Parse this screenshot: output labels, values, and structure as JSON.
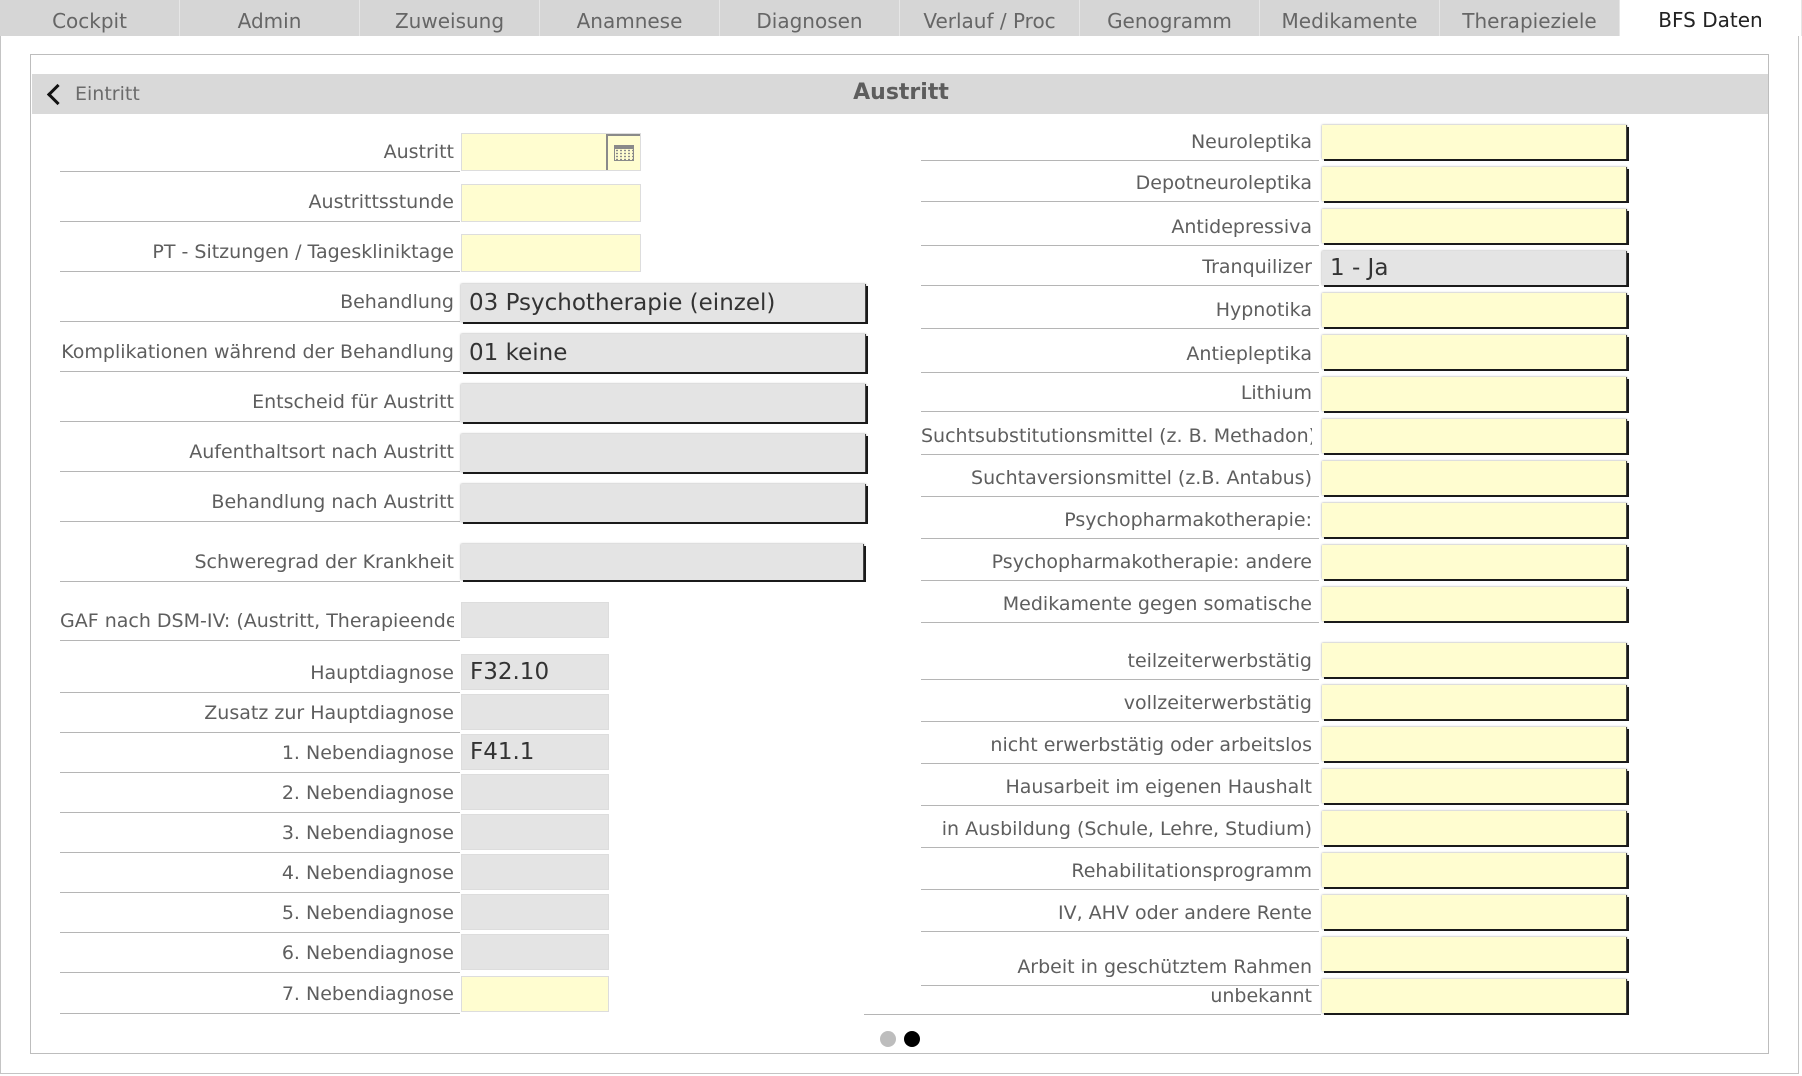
{
  "tabs": [
    {
      "label": "Cockpit",
      "active": false
    },
    {
      "label": "Admin",
      "active": false
    },
    {
      "label": "Zuweisung",
      "active": false
    },
    {
      "label": "Anamnese",
      "active": false
    },
    {
      "label": "Diagnosen",
      "active": false
    },
    {
      "label": "Verlauf / Proc",
      "active": false
    },
    {
      "label": "Genogramm",
      "active": false
    },
    {
      "label": "Medikamente",
      "active": false
    },
    {
      "label": "Therapieziele",
      "active": false
    },
    {
      "label": "BFS Daten",
      "active": true
    }
  ],
  "header": {
    "back_label": "Eintritt",
    "title": "Austritt"
  },
  "left_fields": [
    {
      "label": "Austritt",
      "value": "",
      "style": "yellow",
      "kind": "date"
    },
    {
      "label": "Austrittsstunde",
      "value": "",
      "style": "yellow",
      "kind": "text"
    },
    {
      "label": "PT - Sitzungen /  Tageskliniktage",
      "value": "",
      "style": "yellow",
      "kind": "text"
    },
    {
      "label": "Behandlung",
      "value": "03 Psychotherapie (einzel)",
      "style": "gray",
      "kind": "combo"
    },
    {
      "label": "Komplikationen während der Behandlung",
      "value": "01 keine",
      "style": "gray",
      "kind": "combo"
    },
    {
      "label": "Entscheid für Austritt",
      "value": "",
      "style": "gray",
      "kind": "combo"
    },
    {
      "label": "Aufenthaltsort nach Austritt",
      "value": "",
      "style": "gray",
      "kind": "combo"
    },
    {
      "label": "Behandlung nach Austritt",
      "value": "",
      "style": "gray",
      "kind": "combo"
    },
    {
      "label": "Schweregrad der Krankheit",
      "value": "",
      "style": "gray",
      "kind": "combo"
    },
    {
      "label": "GAF nach DSM-IV: (Austritt, Therapieende)",
      "value": "",
      "style": "gray",
      "kind": "text"
    },
    {
      "label": "Hauptdiagnose",
      "value": "F32.10",
      "style": "gray",
      "kind": "text"
    },
    {
      "label": "Zusatz zur Hauptdiagnose",
      "value": "",
      "style": "gray",
      "kind": "text"
    },
    {
      "label": "1. Nebendiagnose",
      "value": "F41.1",
      "style": "gray",
      "kind": "text"
    },
    {
      "label": "2. Nebendiagnose",
      "value": "",
      "style": "gray",
      "kind": "text"
    },
    {
      "label": "3. Nebendiagnose",
      "value": "",
      "style": "gray",
      "kind": "text"
    },
    {
      "label": "4. Nebendiagnose",
      "value": "",
      "style": "gray",
      "kind": "text"
    },
    {
      "label": "5. Nebendiagnose",
      "value": "",
      "style": "gray",
      "kind": "text"
    },
    {
      "label": "6. Nebendiagnose",
      "value": "",
      "style": "gray",
      "kind": "text"
    },
    {
      "label": "7. Nebendiagnose",
      "value": "",
      "style": "yellow",
      "kind": "text"
    }
  ],
  "right_fields": [
    {
      "label": "Neuroleptika",
      "value": "",
      "style": "yellow"
    },
    {
      "label": "Depotneuroleptika",
      "value": "",
      "style": "yellow"
    },
    {
      "label": "Antidepressiva",
      "value": "",
      "style": "yellow"
    },
    {
      "label": "Tranquilizer",
      "value": "1 - Ja",
      "style": "gray"
    },
    {
      "label": "Hypnotika",
      "value": "",
      "style": "yellow"
    },
    {
      "label": "Antiepleptika",
      "value": "",
      "style": "yellow"
    },
    {
      "label": "Lithium",
      "value": "",
      "style": "yellow"
    },
    {
      "label": "Suchtsubstitutionsmittel (z. B. Methadon)",
      "value": "",
      "style": "yellow"
    },
    {
      "label": "Suchtaversionsmittel (z.B. Antabus)",
      "value": "",
      "style": "yellow"
    },
    {
      "label": "Psychopharmakotherapie:",
      "value": "",
      "style": "yellow"
    },
    {
      "label": "Psychopharmakotherapie: andere",
      "value": "",
      "style": "yellow"
    },
    {
      "label": "Medikamente gegen somatische",
      "value": "",
      "style": "yellow"
    },
    {
      "label": "teilzeiterwerbstätig",
      "value": "",
      "style": "yellow"
    },
    {
      "label": "vollzeiterwerbstätig",
      "value": "",
      "style": "yellow"
    },
    {
      "label": "nicht erwerbstätig oder arbeitslos",
      "value": "",
      "style": "yellow"
    },
    {
      "label": "Hausarbeit im eigenen Haushalt",
      "value": "",
      "style": "yellow"
    },
    {
      "label": "in Ausbildung (Schule, Lehre, Studium)",
      "value": "",
      "style": "yellow"
    },
    {
      "label": "Rehabilitationsprogramm",
      "value": "",
      "style": "yellow"
    },
    {
      "label": "IV, AHV oder andere Rente",
      "value": "",
      "style": "yellow"
    },
    {
      "label": "Arbeit in geschütztem Rahmen",
      "value": "",
      "style": "yellow"
    },
    {
      "label": "unbekannt",
      "value": "",
      "style": "yellow"
    }
  ],
  "pager": {
    "pages": 2,
    "current": 2
  },
  "colors": {
    "field_yellow": "#fffdd0",
    "field_gray": "#e4e4e4",
    "header_gray": "#d9d9d9",
    "tab_gray": "#d6d6d6"
  }
}
